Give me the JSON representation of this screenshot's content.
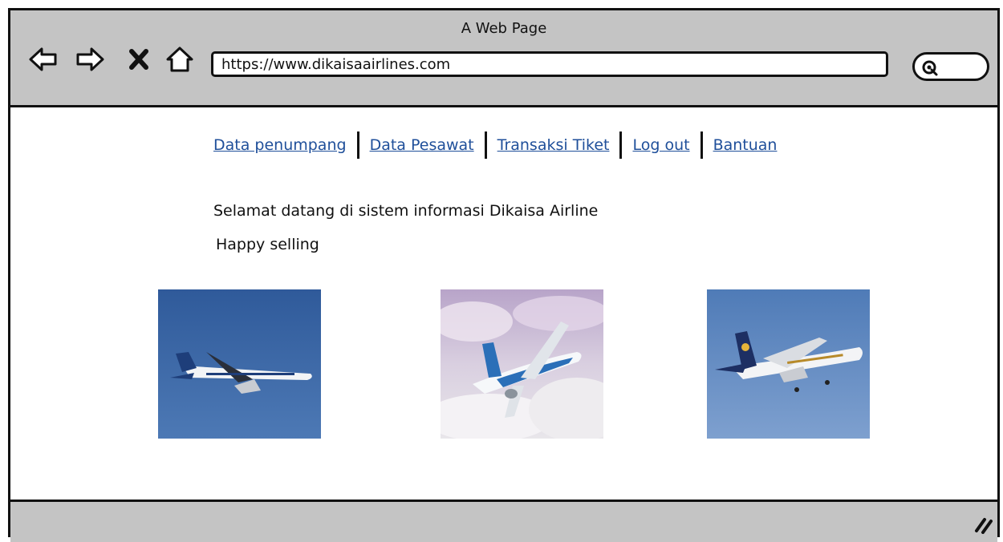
{
  "browser": {
    "title": "A Web Page",
    "url": "https://www.dikaisaairlines.com",
    "nav_icons": [
      "back-arrow-icon",
      "forward-arrow-icon",
      "close-icon",
      "home-icon"
    ],
    "search_icon": "search-icon"
  },
  "menu": {
    "items": [
      {
        "label": "Data penumpang"
      },
      {
        "label": "Data Pesawat"
      },
      {
        "label": "Transaksi Tiket"
      },
      {
        "label": "Log out"
      },
      {
        "label": "Bantuan"
      }
    ]
  },
  "main": {
    "welcome": "Selamat datang di sistem informasi Dikaisa Airline",
    "tagline": "Happy selling"
  },
  "images": [
    {
      "name": "airplane-photo-1",
      "sky": "#3f6aa8"
    },
    {
      "name": "airplane-photo-2",
      "sky": "#c9b8d6"
    },
    {
      "name": "airplane-photo-3",
      "sky": "#5a84bd"
    }
  ],
  "colors": {
    "chrome": "#c4c4c4",
    "link": "#1f4f9a",
    "border": "#111111"
  }
}
